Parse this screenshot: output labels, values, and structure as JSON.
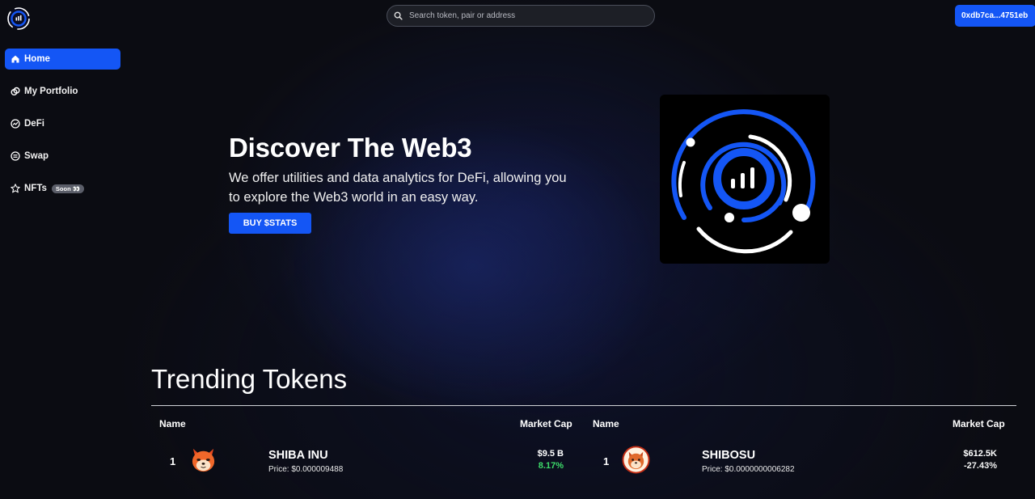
{
  "app": {
    "search_placeholder": "Search token, pair or address",
    "wallet_address": "0xdb7ca...4751eb"
  },
  "sidebar": {
    "items": [
      {
        "label": "Home",
        "icon": "home-icon",
        "active": true
      },
      {
        "label": "My Portfolio",
        "icon": "portfolio-icon"
      },
      {
        "label": "DeFi",
        "icon": "defi-icon"
      },
      {
        "label": "Swap",
        "icon": "swap-icon"
      },
      {
        "label": "NFTs",
        "icon": "star-icon",
        "badge": "Soon 👀"
      }
    ]
  },
  "hero": {
    "title": "Discover The Web3",
    "description": "We offer utilities and data analytics for DeFi, allowing you to explore the Web3 world in an easy way.",
    "button_label": "BUY $STATS"
  },
  "trending": {
    "title": "Trending Tokens",
    "columns": {
      "name": "Name",
      "market_cap": "Market Cap"
    },
    "tokens": [
      {
        "rank": "1",
        "name": "SHIBA INU",
        "price": "Price: $0.000009488",
        "market_cap": "$9.5 B",
        "change": "8.17%",
        "change_color": "#3ddc6a",
        "icon": "shiba-inu-icon"
      },
      {
        "rank": "1",
        "name": "SHIBOSU",
        "price": "Price: $0.0000000006282",
        "market_cap": "$612.5K",
        "change": "-27.43%",
        "change_color": "#f2f2f2",
        "icon": "shibosu-icon"
      }
    ]
  },
  "colors": {
    "accent": "#1456f5",
    "background": "#0b0c12",
    "positive": "#3ddc6a"
  }
}
